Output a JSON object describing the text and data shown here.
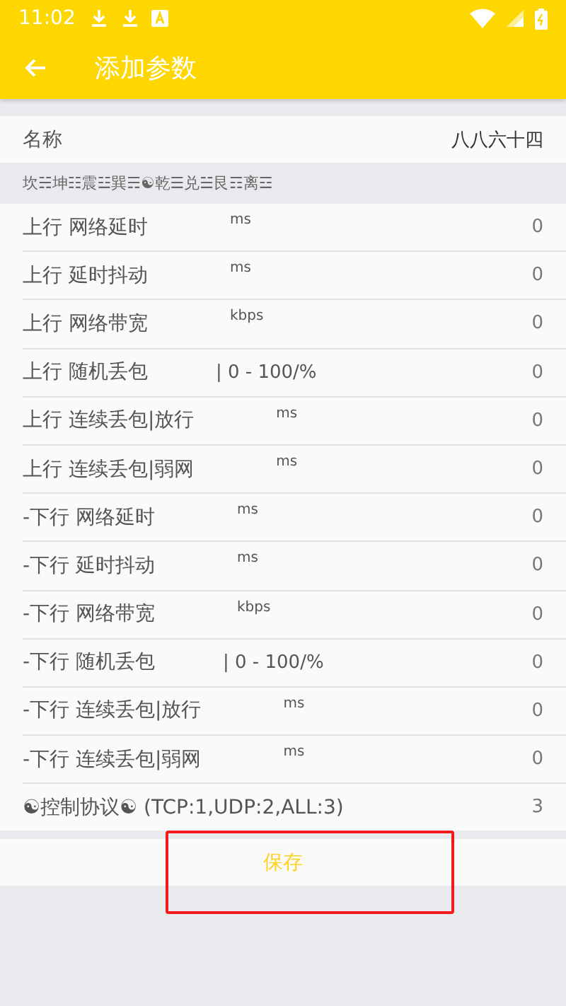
{
  "status_bar": {
    "time": "11:02"
  },
  "app_bar": {
    "title": "添加参数"
  },
  "name_field": {
    "label": "名称",
    "value": "八八六十四"
  },
  "section_header": "坎☵坤☷震☳巽☴☯乾☰兑☱艮☶离☲",
  "params": [
    {
      "label": "上行 网络延时",
      "kind": "unit",
      "unit": "ms",
      "value": "0"
    },
    {
      "label": "上行 延时抖动",
      "kind": "unit",
      "unit": "ms",
      "value": "0"
    },
    {
      "label": "上行 网络带宽",
      "kind": "unit",
      "unit": "kbps",
      "value": "0"
    },
    {
      "label": "上行 随机丢包",
      "kind": "range",
      "unit": "| 0 - 100/%",
      "value": "0"
    },
    {
      "label": "上行 连续丢包|放行",
      "kind": "unit",
      "unit": "ms",
      "value": "0"
    },
    {
      "label": "上行 连续丢包|弱网",
      "kind": "unit",
      "unit": "ms",
      "value": "0"
    },
    {
      "label": "-下行 网络延时",
      "kind": "unit",
      "unit": "ms",
      "value": "0"
    },
    {
      "label": "-下行 延时抖动",
      "kind": "unit",
      "unit": "ms",
      "value": "0"
    },
    {
      "label": "-下行 网络带宽",
      "kind": "unit",
      "unit": "kbps",
      "value": "0"
    },
    {
      "label": "-下行 随机丢包",
      "kind": "range",
      "unit": "| 0 - 100/%",
      "value": "0"
    },
    {
      "label": "-下行 连续丢包|放行",
      "kind": "unit",
      "unit": "ms",
      "value": "0"
    },
    {
      "label": "-下行 连续丢包|弱网",
      "kind": "unit",
      "unit": "ms",
      "value": "0"
    },
    {
      "label": "☯控制协议☯ (TCP:1,UDP:2,ALL:3)",
      "kind": "plain",
      "value": "3"
    }
  ],
  "save_button": "保存"
}
